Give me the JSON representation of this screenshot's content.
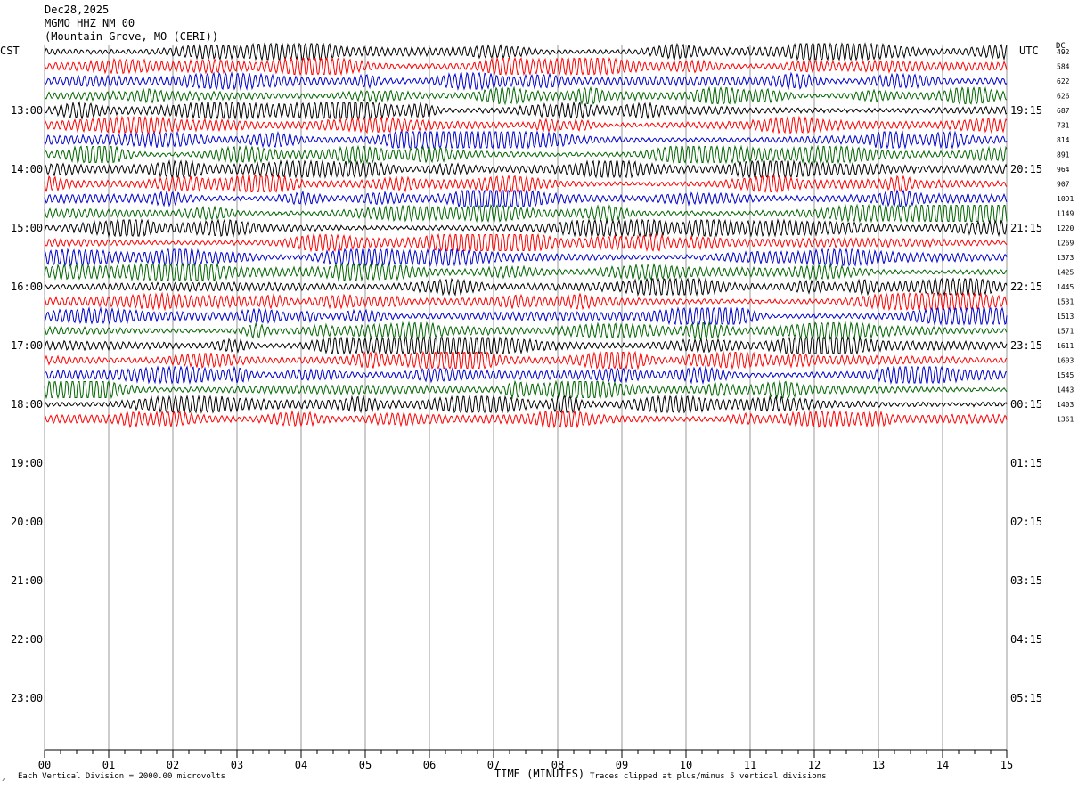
{
  "header": {
    "date": "Dec28,2025",
    "station": "MGMO HHZ NM 00",
    "location": "(Mountain Grove, MO (CERI))"
  },
  "corners": {
    "left_tz": "CST",
    "right_tz": "UTC",
    "dc_label": "DC"
  },
  "footer": {
    "scale": "Each Vertical Division = 2000.00 microvolts",
    "xlabel": "TIME (MINUTES)",
    "clip": "Traces clipped at plus/minus 5 vertical divisions",
    "mark": "↗"
  },
  "chart_data": {
    "type": "line",
    "subtype": "helicorder",
    "xlabel": "TIME (MINUTES)",
    "x_ticks": [
      "00",
      "01",
      "02",
      "03",
      "04",
      "05",
      "06",
      "07",
      "08",
      "09",
      "10",
      "11",
      "12",
      "13",
      "14",
      "15"
    ],
    "xlim": [
      0,
      15
    ],
    "minor_ticks_per_minute": 4,
    "left_hour_labels": [
      "13:00",
      "14:00",
      "15:00",
      "16:00",
      "17:00",
      "18:00",
      "19:00",
      "20:00",
      "21:00",
      "22:00",
      "23:00"
    ],
    "right_hour_labels": [
      "19:15",
      "20:15",
      "21:15",
      "22:15",
      "23:15",
      "00:15",
      "01:15",
      "02:15",
      "03:15",
      "04:15",
      "05:15"
    ],
    "rows_per_hour": 4,
    "row_count": 40,
    "trace_colors": [
      "#000000",
      "#ff0000",
      "#0000cc",
      "#006600"
    ],
    "dc_offsets": [
      492,
      584,
      622,
      626,
      687,
      731,
      814,
      891,
      964,
      907,
      1091,
      1149,
      1220,
      1269,
      1373,
      1425,
      1445,
      1531,
      1513,
      1571,
      1611,
      1603,
      1545,
      1443,
      1403,
      1361
    ],
    "grid": true
  }
}
